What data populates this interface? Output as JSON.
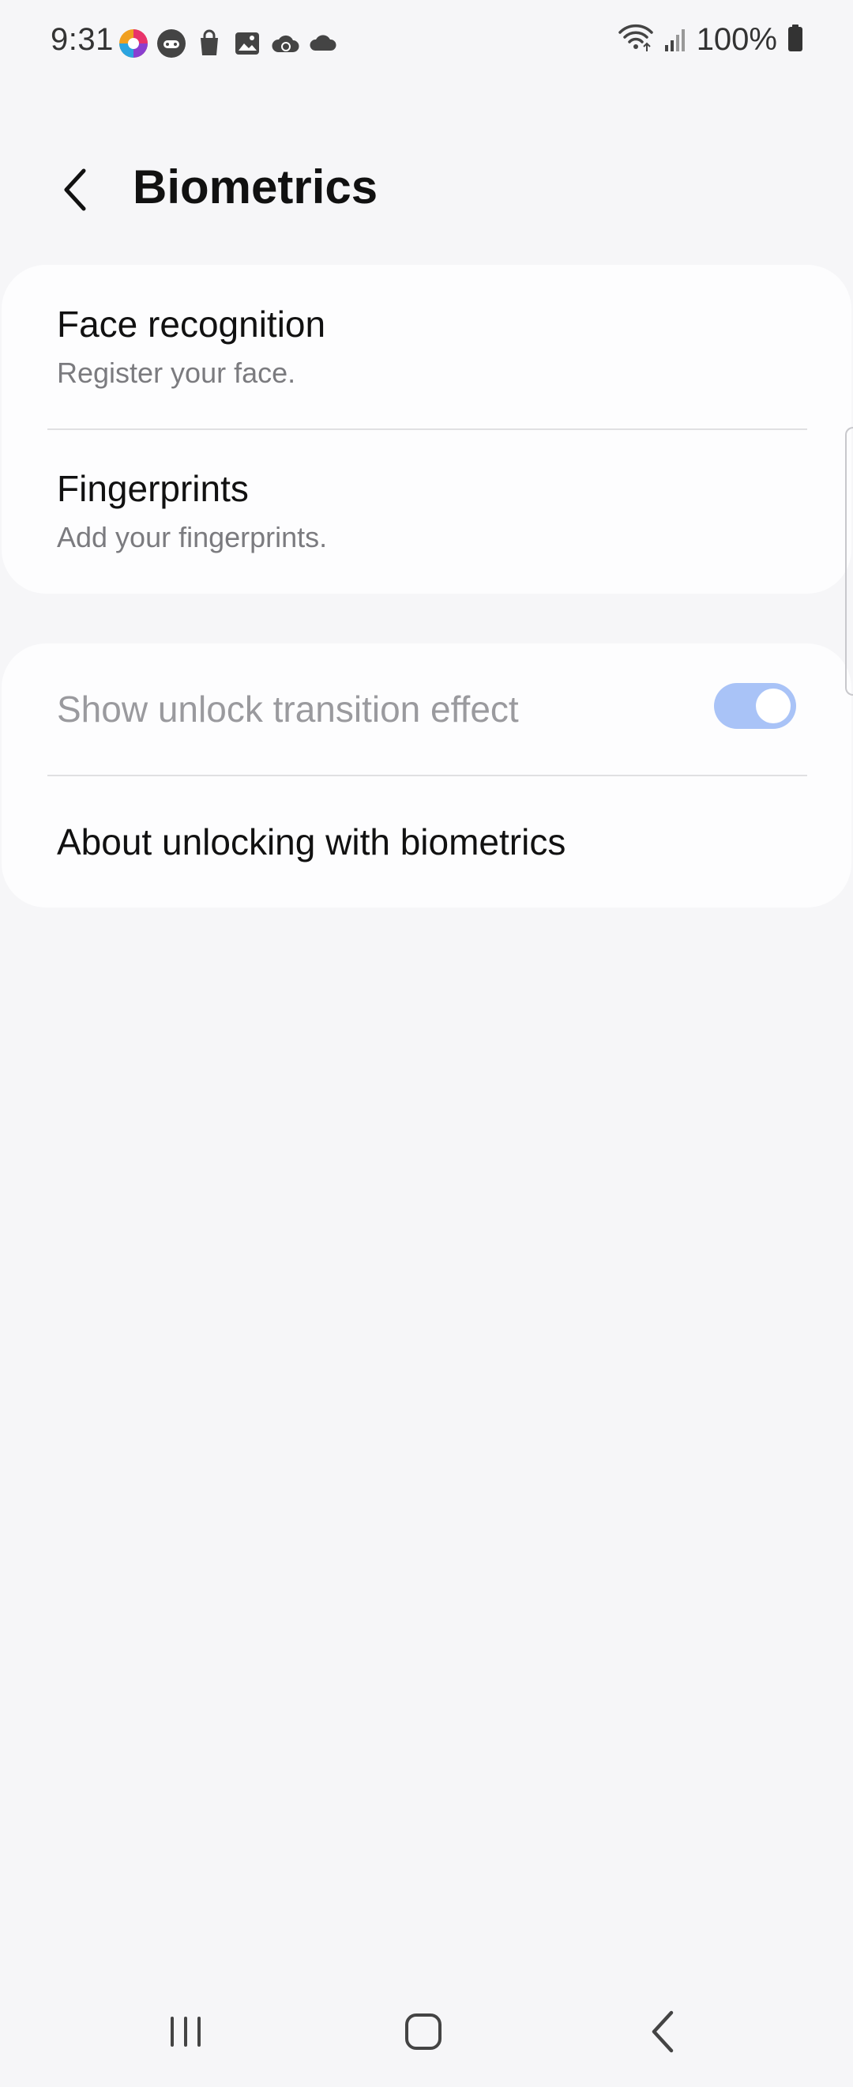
{
  "status_bar": {
    "time": "9:31",
    "notification_icons": [
      "colorful-app-icon",
      "game-controller-icon",
      "shopping-bag-icon",
      "gallery-icon",
      "cloud-sync-icon",
      "cloud-icon"
    ],
    "battery_text": "100%",
    "right_icons": [
      "wifi-icon",
      "signal-icon",
      "battery-icon"
    ]
  },
  "header": {
    "back_icon": "chevron-left-icon",
    "title": "Biometrics"
  },
  "card_1": {
    "items": [
      {
        "title": "Face recognition",
        "subtitle": "Register your face."
      },
      {
        "title": "Fingerprints",
        "subtitle": "Add your fingerprints."
      }
    ]
  },
  "card_2": {
    "transition": {
      "title": "Show unlock transition effect",
      "enabled": true
    },
    "about": {
      "title": "About unlocking with biometrics"
    }
  },
  "nav_bar": {
    "items": [
      "recent-apps-icon",
      "home-icon",
      "back-icon"
    ]
  },
  "colors": {
    "background": "#f6f6f8",
    "card": "#fdfdfe",
    "toggle_track": "#a9c3f7",
    "subtitle": "#7b7b7f",
    "disabled_text": "#9a9a9e"
  }
}
